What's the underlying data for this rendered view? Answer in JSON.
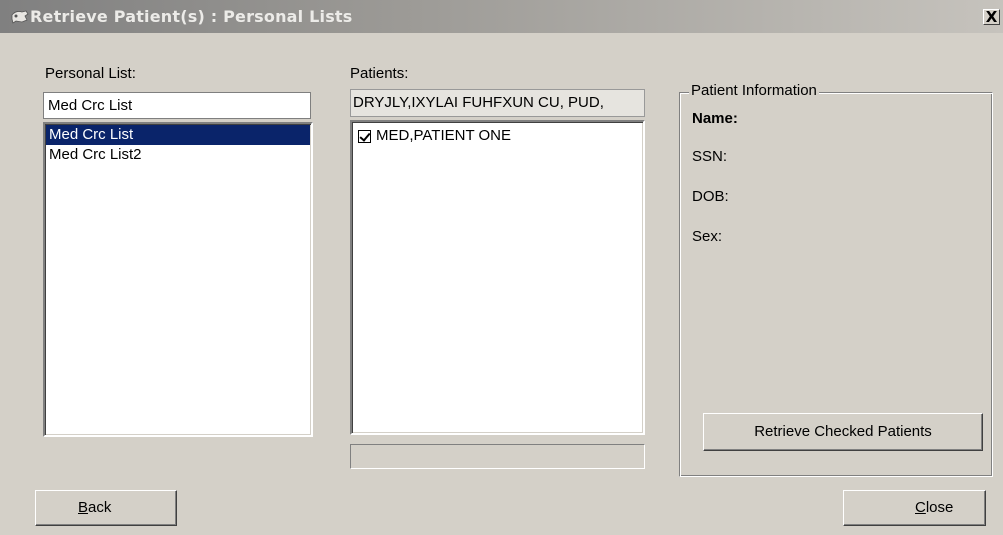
{
  "window": {
    "title": "Retrieve Patient(s) : Personal Lists",
    "close_glyph": "X"
  },
  "personal_list": {
    "label": "Personal List:",
    "input_value": "Med Crc List",
    "items": [
      {
        "label": "Med Crc List",
        "selected": true
      },
      {
        "label": "Med Crc List2",
        "selected": false
      }
    ]
  },
  "patients": {
    "label": "Patients:",
    "header_text": "DRYJLY,IXYLAI FUHFXUN CU, PUD,",
    "items": [
      {
        "label": "MED,PATIENT ONE",
        "checked": true
      }
    ]
  },
  "patient_info": {
    "group_label": "Patient Information",
    "name_label": "Name:",
    "ssn_label": "SSN:",
    "dob_label": "DOB:",
    "sex_label": "Sex:",
    "retrieve_button": "Retrieve Checked Patients"
  },
  "buttons": {
    "back_underlined": "B",
    "back_rest": "ack",
    "close_underlined": "C",
    "close_rest": "lose"
  },
  "colors": {
    "window_bg": "#d4d0c8",
    "selection_bg": "#0a246a"
  }
}
